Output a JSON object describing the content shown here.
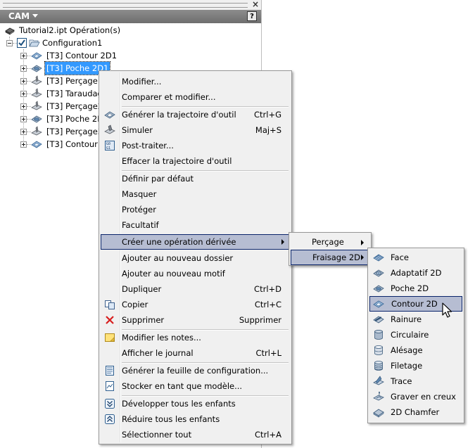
{
  "panel": {
    "title": "CAM",
    "help_label": "?",
    "root_label": "Tutorial2.ipt Opération(s)",
    "config_label": "Configuration1",
    "operations": [
      {
        "label": "[T3] Contour 2D1",
        "selected": false
      },
      {
        "label": "[T3] Poche 2D1",
        "selected": true
      },
      {
        "label": "[T3] Perçage1",
        "selected": false
      },
      {
        "label": "[T3] Taraudag",
        "selected": false
      },
      {
        "label": "[T3] Perçage2",
        "selected": false
      },
      {
        "label": "[T3] Poche 2D",
        "selected": false
      },
      {
        "label": "[T3] Perçage3",
        "selected": false
      },
      {
        "label": "[T3] Contour 2",
        "selected": false
      }
    ]
  },
  "context_menu": {
    "items": [
      {
        "label": "Modifier...",
        "shortcut": ""
      },
      {
        "label": "Comparer et modifier...",
        "shortcut": ""
      },
      {
        "label": "Générer la trajectoire d'outil",
        "shortcut": "Ctrl+G"
      },
      {
        "label": "Simuler",
        "shortcut": "Maj+S"
      },
      {
        "label": "Post-traiter...",
        "shortcut": ""
      },
      {
        "label": "Effacer la trajectoire d'outil",
        "shortcut": ""
      },
      {
        "label": "Définir par défaut",
        "shortcut": ""
      },
      {
        "label": "Masquer",
        "shortcut": ""
      },
      {
        "label": "Protéger",
        "shortcut": ""
      },
      {
        "label": "Facultatif",
        "shortcut": ""
      },
      {
        "label": "Créer une opération dérivée",
        "shortcut": ""
      },
      {
        "label": "Ajouter au nouveau dossier",
        "shortcut": ""
      },
      {
        "label": "Ajouter au nouveau motif",
        "shortcut": ""
      },
      {
        "label": "Dupliquer",
        "shortcut": "Ctrl+D"
      },
      {
        "label": "Copier",
        "shortcut": "Ctrl+C"
      },
      {
        "label": "Supprimer",
        "shortcut": "Supprimer"
      },
      {
        "label": "Modifier les notes...",
        "shortcut": ""
      },
      {
        "label": "Afficher le journal",
        "shortcut": "Ctrl+L"
      },
      {
        "label": "Générer la feuille de configuration...",
        "shortcut": ""
      },
      {
        "label": "Stocker en tant que modèle...",
        "shortcut": ""
      },
      {
        "label": "Développer tous les enfants",
        "shortcut": ""
      },
      {
        "label": "Réduire tous les enfants",
        "shortcut": ""
      },
      {
        "label": "Sélectionner tout",
        "shortcut": "Ctrl+A"
      }
    ]
  },
  "derived_submenu": {
    "items": [
      {
        "label": "Perçage"
      },
      {
        "label": "Fraisage 2D"
      }
    ]
  },
  "milling_submenu": {
    "items": [
      {
        "label": "Face"
      },
      {
        "label": "Adaptatif 2D"
      },
      {
        "label": "Poche 2D"
      },
      {
        "label": "Contour 2D"
      },
      {
        "label": "Rainure"
      },
      {
        "label": "Circulaire"
      },
      {
        "label": "Alésage"
      },
      {
        "label": "Filetage"
      },
      {
        "label": "Trace"
      },
      {
        "label": "Graver en creux"
      },
      {
        "label": "2D Chamfer"
      }
    ]
  },
  "colors": {
    "selection": "#3399ff",
    "menu_highlight": "#b6bdd2",
    "menu_bg": "#f0f0f0",
    "titlebar": "#7a7a7a"
  }
}
